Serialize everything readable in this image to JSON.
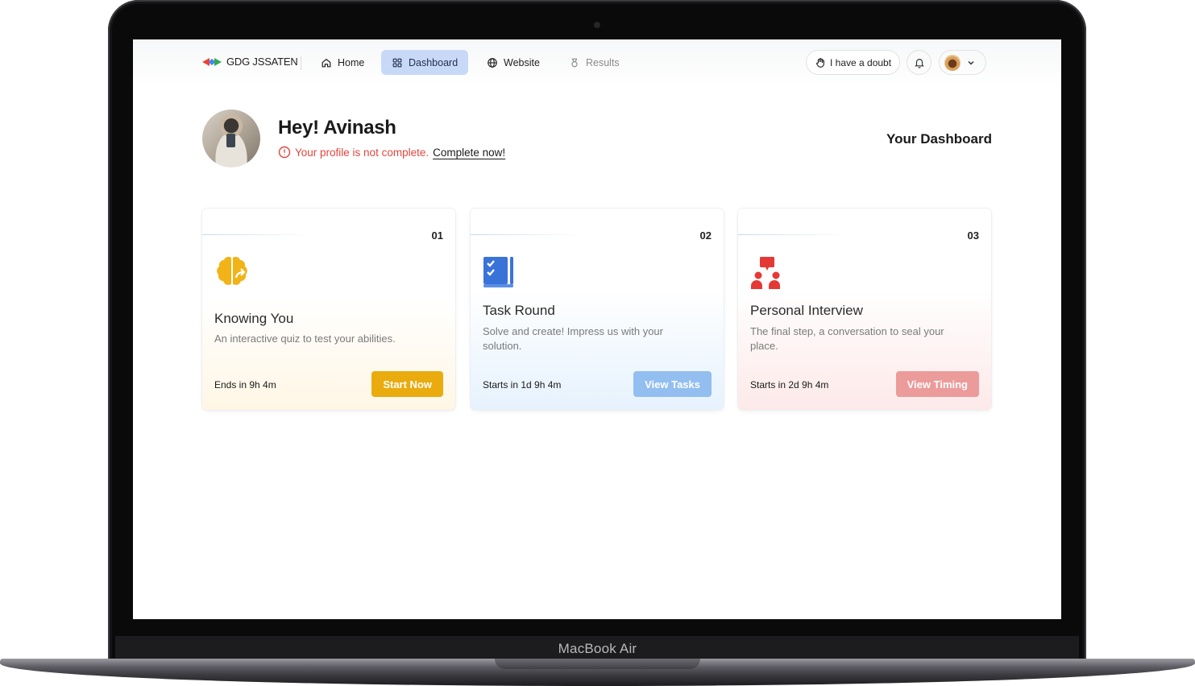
{
  "device": {
    "label": "MacBook Air"
  },
  "nav": {
    "brand": "GDG JSSATEN",
    "items": [
      {
        "label": "Home",
        "icon": "home-icon"
      },
      {
        "label": "Dashboard",
        "icon": "grid-icon",
        "active": true
      },
      {
        "label": "Website",
        "icon": "globe-icon"
      },
      {
        "label": "Results",
        "icon": "medal-icon",
        "disabled": true
      }
    ],
    "doubt_label": "I have a doubt",
    "accent": "#c7d9f7"
  },
  "header": {
    "greeting": "Hey! Avinash",
    "warning": "Your profile is not complete.",
    "warning_link": "Complete now!",
    "dashboard_title": "Your Dashboard",
    "warning_color": "#e2463f"
  },
  "cards": [
    {
      "number": "01",
      "title": "Knowing You",
      "description": "An interactive quiz to test your abilities.",
      "meta": "Ends in 9h 4m",
      "button": "Start Now",
      "icon": "brain-icon",
      "color": "#e9ab0e"
    },
    {
      "number": "02",
      "title": "Task Round",
      "description": "Solve and create! Impress us with your solution.",
      "meta": "Starts in 1d 9h 4m",
      "button": "View Tasks",
      "icon": "task-book-icon",
      "color": "#93bef0"
    },
    {
      "number": "03",
      "title": "Personal Interview",
      "description": "The final step, a conversation to seal your place.",
      "meta": "Starts in 2d 9h 4m",
      "button": "View Timing",
      "icon": "interview-icon",
      "color": "#ec9b9b"
    }
  ]
}
